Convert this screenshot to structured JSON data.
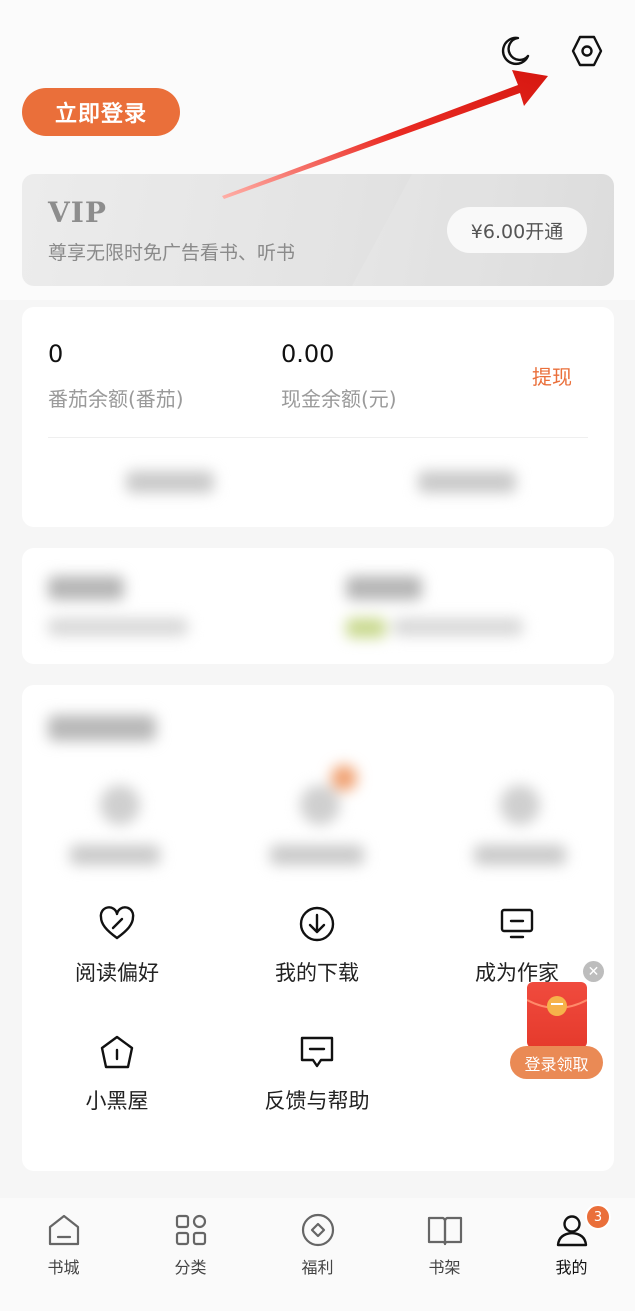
{
  "header": {
    "login_button": "立即登录",
    "icons": [
      "moon-icon",
      "settings-icon"
    ]
  },
  "vip": {
    "title": "VIP",
    "subtitle": "尊享无限时免广告看书、听书",
    "button": "¥6.00开通"
  },
  "balance": {
    "tomato_value": "0",
    "tomato_label": "番茄余额(番茄)",
    "cash_value": "0.00",
    "cash_label": "现金余额(元)",
    "withdraw": "提现"
  },
  "services": {
    "row1": [
      {
        "label": "阅读偏好",
        "icon": "heart-pen-icon"
      },
      {
        "label": "我的下载",
        "icon": "download-icon"
      },
      {
        "label": "成为作家",
        "icon": "monitor-icon"
      }
    ],
    "row2": [
      {
        "label": "小黑屋",
        "icon": "house-icon"
      },
      {
        "label": "反馈与帮助",
        "icon": "chat-icon"
      }
    ]
  },
  "floating": {
    "redpacket_label": "登录领取"
  },
  "tabbar": {
    "tabs": [
      {
        "label": "书城",
        "icon": "home-icon"
      },
      {
        "label": "分类",
        "icon": "grid-icon"
      },
      {
        "label": "福利",
        "icon": "coin-icon"
      },
      {
        "label": "书架",
        "icon": "book-icon"
      },
      {
        "label": "我的",
        "icon": "user-icon",
        "active": true
      }
    ],
    "badge": "3"
  },
  "colors": {
    "accent": "#ea6f3a",
    "annotation_arrow": "#e8231d"
  }
}
